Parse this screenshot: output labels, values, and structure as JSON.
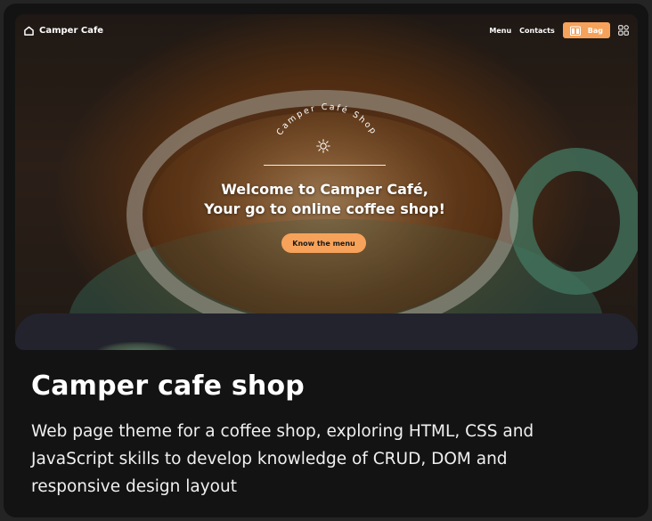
{
  "preview": {
    "brand": {
      "name": "Camper Cafe",
      "icon": "home-icon"
    },
    "nav": {
      "links": [
        "Menu",
        "Contacts"
      ],
      "bag_label": "Bag",
      "bag_icon": "bag-icon",
      "apps_icon": "grid-icon"
    },
    "hero": {
      "arc_text": "Camper Café Shop",
      "headline_line1": "Welcome to Camper Café,",
      "headline_line2": "Your go to online coffee shop!",
      "cta_label": "Know the menu"
    }
  },
  "card": {
    "title": "Camper cafe shop",
    "description": "Web page theme for a coffee shop, exploring HTML, CSS and JavaScript skills to develop knowledge of CRUD, DOM and responsive design layout"
  },
  "colors": {
    "accent": "#f6a25a",
    "card_bg": "#131313",
    "page_bg": "#242424",
    "section_bg": "#23232e"
  }
}
